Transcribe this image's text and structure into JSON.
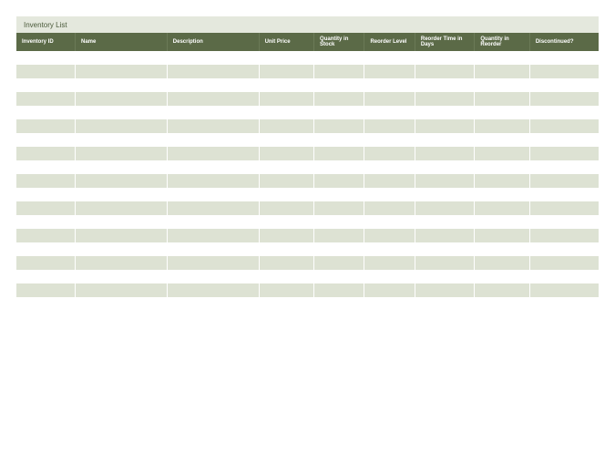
{
  "title": "Inventory List",
  "columns": [
    "Inventory ID",
    "Name",
    "Description",
    "Unit Price",
    "Quantity in Stock",
    "Reorder Level",
    "Reorder Time in Days",
    "Quantity in Reorder",
    "Discontinued?"
  ],
  "rows": [
    [
      "",
      "",
      "",
      "",
      "",
      "",
      "",
      "",
      ""
    ],
    [
      "",
      "",
      "",
      "",
      "",
      "",
      "",
      "",
      ""
    ],
    [
      "",
      "",
      "",
      "",
      "",
      "",
      "",
      "",
      ""
    ],
    [
      "",
      "",
      "",
      "",
      "",
      "",
      "",
      "",
      ""
    ],
    [
      "",
      "",
      "",
      "",
      "",
      "",
      "",
      "",
      ""
    ],
    [
      "",
      "",
      "",
      "",
      "",
      "",
      "",
      "",
      ""
    ],
    [
      "",
      "",
      "",
      "",
      "",
      "",
      "",
      "",
      ""
    ],
    [
      "",
      "",
      "",
      "",
      "",
      "",
      "",
      "",
      ""
    ],
    [
      "",
      "",
      "",
      "",
      "",
      "",
      "",
      "",
      ""
    ],
    [
      "",
      "",
      "",
      "",
      "",
      "",
      "",
      "",
      ""
    ],
    [
      "",
      "",
      "",
      "",
      "",
      "",
      "",
      "",
      ""
    ],
    [
      "",
      "",
      "",
      "",
      "",
      "",
      "",
      "",
      ""
    ],
    [
      "",
      "",
      "",
      "",
      "",
      "",
      "",
      "",
      ""
    ],
    [
      "",
      "",
      "",
      "",
      "",
      "",
      "",
      "",
      ""
    ],
    [
      "",
      "",
      "",
      "",
      "",
      "",
      "",
      "",
      ""
    ],
    [
      "",
      "",
      "",
      "",
      "",
      "",
      "",
      "",
      ""
    ],
    [
      "",
      "",
      "",
      "",
      "",
      "",
      "",
      "",
      ""
    ],
    [
      "",
      "",
      "",
      "",
      "",
      "",
      "",
      "",
      ""
    ]
  ]
}
